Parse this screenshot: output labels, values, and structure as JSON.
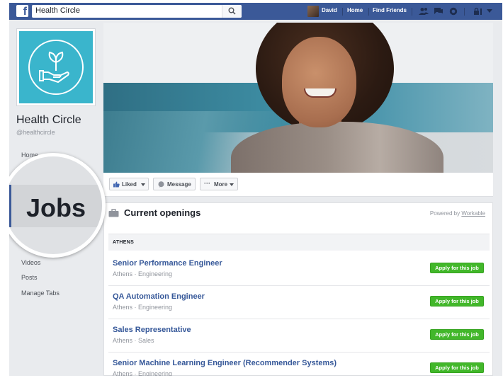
{
  "topbar": {
    "search_value": "Health Circle",
    "profile_name": "David",
    "nav_home": "Home",
    "nav_find_friends": "Find Friends",
    "icons": [
      "facebook-logo",
      "search-icon",
      "friend-requests-icon",
      "messages-icon",
      "notifications-icon",
      "privacy-icon",
      "account-menu-icon"
    ]
  },
  "page": {
    "name": "Health Circle",
    "handle": "@healthcircle",
    "brand_color": "#3ab5cc"
  },
  "left_nav": {
    "items": [
      "Home",
      "Videos",
      "Posts",
      "Manage Tabs"
    ],
    "magnified_tab": "Jobs"
  },
  "actions": {
    "liked": "Liked",
    "message": "Message",
    "more": "More"
  },
  "jobs": {
    "title": "Current openings",
    "powered_prefix": "Powered by",
    "powered_link": "Workable",
    "location": "ATHENS",
    "apply_label": "Apply for this job",
    "apply_color": "#42b72a",
    "list": [
      {
        "title": "Senior Performance Engineer",
        "meta": "Athens · Engineering"
      },
      {
        "title": "QA Automation Engineer",
        "meta": "Athens · Engineering"
      },
      {
        "title": "Sales Representative",
        "meta": "Athens · Sales"
      },
      {
        "title": "Senior Machine Learning Engineer (Recommender Systems)",
        "meta": "Athens · Engineering"
      }
    ]
  }
}
